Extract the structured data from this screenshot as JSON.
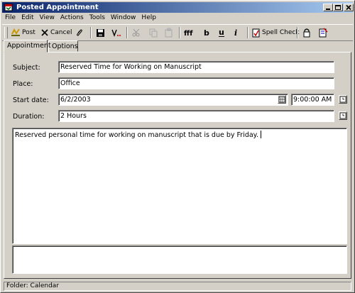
{
  "window": {
    "title": "Posted Appointment"
  },
  "menu": [
    "File",
    "Edit",
    "View",
    "Actions",
    "Tools",
    "Window",
    "Help"
  ],
  "toolbar": {
    "post_label": "Post",
    "cancel_label": "Cancel",
    "spell_check_label": "Spell Check"
  },
  "tabs": [
    {
      "label": "Appointment",
      "active": true
    },
    {
      "label": "Options",
      "active": false
    }
  ],
  "form": {
    "subject_label": "Subject:",
    "subject_value": "Reserved Time for Working on Manuscript",
    "place_label": "Place:",
    "place_value": "Office",
    "start_date_label": "Start date:",
    "start_date_value": "6/2/2003",
    "start_time_value": "9:00:00 AM",
    "duration_label": "Duration:",
    "duration_value": "2 Hours",
    "notes": "Reserved personal time for working on manuscript that is due by Friday.",
    "attachments": ""
  },
  "status": {
    "folder": "Folder: Calendar"
  },
  "colors": {
    "titlebar_start": "#0a246a",
    "titlebar_end": "#a6caf0",
    "face": "#d4d0c8"
  }
}
